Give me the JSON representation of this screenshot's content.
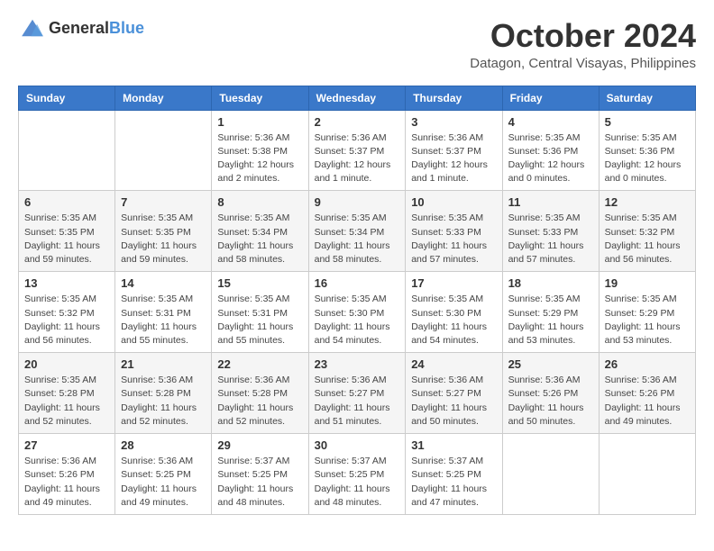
{
  "header": {
    "logo": {
      "general": "General",
      "blue": "Blue"
    },
    "month": "October 2024",
    "location": "Datagon, Central Visayas, Philippines"
  },
  "weekdays": [
    "Sunday",
    "Monday",
    "Tuesday",
    "Wednesday",
    "Thursday",
    "Friday",
    "Saturday"
  ],
  "weeks": [
    [
      {
        "day": null
      },
      {
        "day": null
      },
      {
        "day": "1",
        "sunrise": "Sunrise: 5:36 AM",
        "sunset": "Sunset: 5:38 PM",
        "daylight": "Daylight: 12 hours and 2 minutes."
      },
      {
        "day": "2",
        "sunrise": "Sunrise: 5:36 AM",
        "sunset": "Sunset: 5:37 PM",
        "daylight": "Daylight: 12 hours and 1 minute."
      },
      {
        "day": "3",
        "sunrise": "Sunrise: 5:36 AM",
        "sunset": "Sunset: 5:37 PM",
        "daylight": "Daylight: 12 hours and 1 minute."
      },
      {
        "day": "4",
        "sunrise": "Sunrise: 5:35 AM",
        "sunset": "Sunset: 5:36 PM",
        "daylight": "Daylight: 12 hours and 0 minutes."
      },
      {
        "day": "5",
        "sunrise": "Sunrise: 5:35 AM",
        "sunset": "Sunset: 5:36 PM",
        "daylight": "Daylight: 12 hours and 0 minutes."
      }
    ],
    [
      {
        "day": "6",
        "sunrise": "Sunrise: 5:35 AM",
        "sunset": "Sunset: 5:35 PM",
        "daylight": "Daylight: 11 hours and 59 minutes."
      },
      {
        "day": "7",
        "sunrise": "Sunrise: 5:35 AM",
        "sunset": "Sunset: 5:35 PM",
        "daylight": "Daylight: 11 hours and 59 minutes."
      },
      {
        "day": "8",
        "sunrise": "Sunrise: 5:35 AM",
        "sunset": "Sunset: 5:34 PM",
        "daylight": "Daylight: 11 hours and 58 minutes."
      },
      {
        "day": "9",
        "sunrise": "Sunrise: 5:35 AM",
        "sunset": "Sunset: 5:34 PM",
        "daylight": "Daylight: 11 hours and 58 minutes."
      },
      {
        "day": "10",
        "sunrise": "Sunrise: 5:35 AM",
        "sunset": "Sunset: 5:33 PM",
        "daylight": "Daylight: 11 hours and 57 minutes."
      },
      {
        "day": "11",
        "sunrise": "Sunrise: 5:35 AM",
        "sunset": "Sunset: 5:33 PM",
        "daylight": "Daylight: 11 hours and 57 minutes."
      },
      {
        "day": "12",
        "sunrise": "Sunrise: 5:35 AM",
        "sunset": "Sunset: 5:32 PM",
        "daylight": "Daylight: 11 hours and 56 minutes."
      }
    ],
    [
      {
        "day": "13",
        "sunrise": "Sunrise: 5:35 AM",
        "sunset": "Sunset: 5:32 PM",
        "daylight": "Daylight: 11 hours and 56 minutes."
      },
      {
        "day": "14",
        "sunrise": "Sunrise: 5:35 AM",
        "sunset": "Sunset: 5:31 PM",
        "daylight": "Daylight: 11 hours and 55 minutes."
      },
      {
        "day": "15",
        "sunrise": "Sunrise: 5:35 AM",
        "sunset": "Sunset: 5:31 PM",
        "daylight": "Daylight: 11 hours and 55 minutes."
      },
      {
        "day": "16",
        "sunrise": "Sunrise: 5:35 AM",
        "sunset": "Sunset: 5:30 PM",
        "daylight": "Daylight: 11 hours and 54 minutes."
      },
      {
        "day": "17",
        "sunrise": "Sunrise: 5:35 AM",
        "sunset": "Sunset: 5:30 PM",
        "daylight": "Daylight: 11 hours and 54 minutes."
      },
      {
        "day": "18",
        "sunrise": "Sunrise: 5:35 AM",
        "sunset": "Sunset: 5:29 PM",
        "daylight": "Daylight: 11 hours and 53 minutes."
      },
      {
        "day": "19",
        "sunrise": "Sunrise: 5:35 AM",
        "sunset": "Sunset: 5:29 PM",
        "daylight": "Daylight: 11 hours and 53 minutes."
      }
    ],
    [
      {
        "day": "20",
        "sunrise": "Sunrise: 5:35 AM",
        "sunset": "Sunset: 5:28 PM",
        "daylight": "Daylight: 11 hours and 52 minutes."
      },
      {
        "day": "21",
        "sunrise": "Sunrise: 5:36 AM",
        "sunset": "Sunset: 5:28 PM",
        "daylight": "Daylight: 11 hours and 52 minutes."
      },
      {
        "day": "22",
        "sunrise": "Sunrise: 5:36 AM",
        "sunset": "Sunset: 5:28 PM",
        "daylight": "Daylight: 11 hours and 52 minutes."
      },
      {
        "day": "23",
        "sunrise": "Sunrise: 5:36 AM",
        "sunset": "Sunset: 5:27 PM",
        "daylight": "Daylight: 11 hours and 51 minutes."
      },
      {
        "day": "24",
        "sunrise": "Sunrise: 5:36 AM",
        "sunset": "Sunset: 5:27 PM",
        "daylight": "Daylight: 11 hours and 50 minutes."
      },
      {
        "day": "25",
        "sunrise": "Sunrise: 5:36 AM",
        "sunset": "Sunset: 5:26 PM",
        "daylight": "Daylight: 11 hours and 50 minutes."
      },
      {
        "day": "26",
        "sunrise": "Sunrise: 5:36 AM",
        "sunset": "Sunset: 5:26 PM",
        "daylight": "Daylight: 11 hours and 49 minutes."
      }
    ],
    [
      {
        "day": "27",
        "sunrise": "Sunrise: 5:36 AM",
        "sunset": "Sunset: 5:26 PM",
        "daylight": "Daylight: 11 hours and 49 minutes."
      },
      {
        "day": "28",
        "sunrise": "Sunrise: 5:36 AM",
        "sunset": "Sunset: 5:25 PM",
        "daylight": "Daylight: 11 hours and 49 minutes."
      },
      {
        "day": "29",
        "sunrise": "Sunrise: 5:37 AM",
        "sunset": "Sunset: 5:25 PM",
        "daylight": "Daylight: 11 hours and 48 minutes."
      },
      {
        "day": "30",
        "sunrise": "Sunrise: 5:37 AM",
        "sunset": "Sunset: 5:25 PM",
        "daylight": "Daylight: 11 hours and 48 minutes."
      },
      {
        "day": "31",
        "sunrise": "Sunrise: 5:37 AM",
        "sunset": "Sunset: 5:25 PM",
        "daylight": "Daylight: 11 hours and 47 minutes."
      },
      {
        "day": null
      },
      {
        "day": null
      }
    ]
  ]
}
